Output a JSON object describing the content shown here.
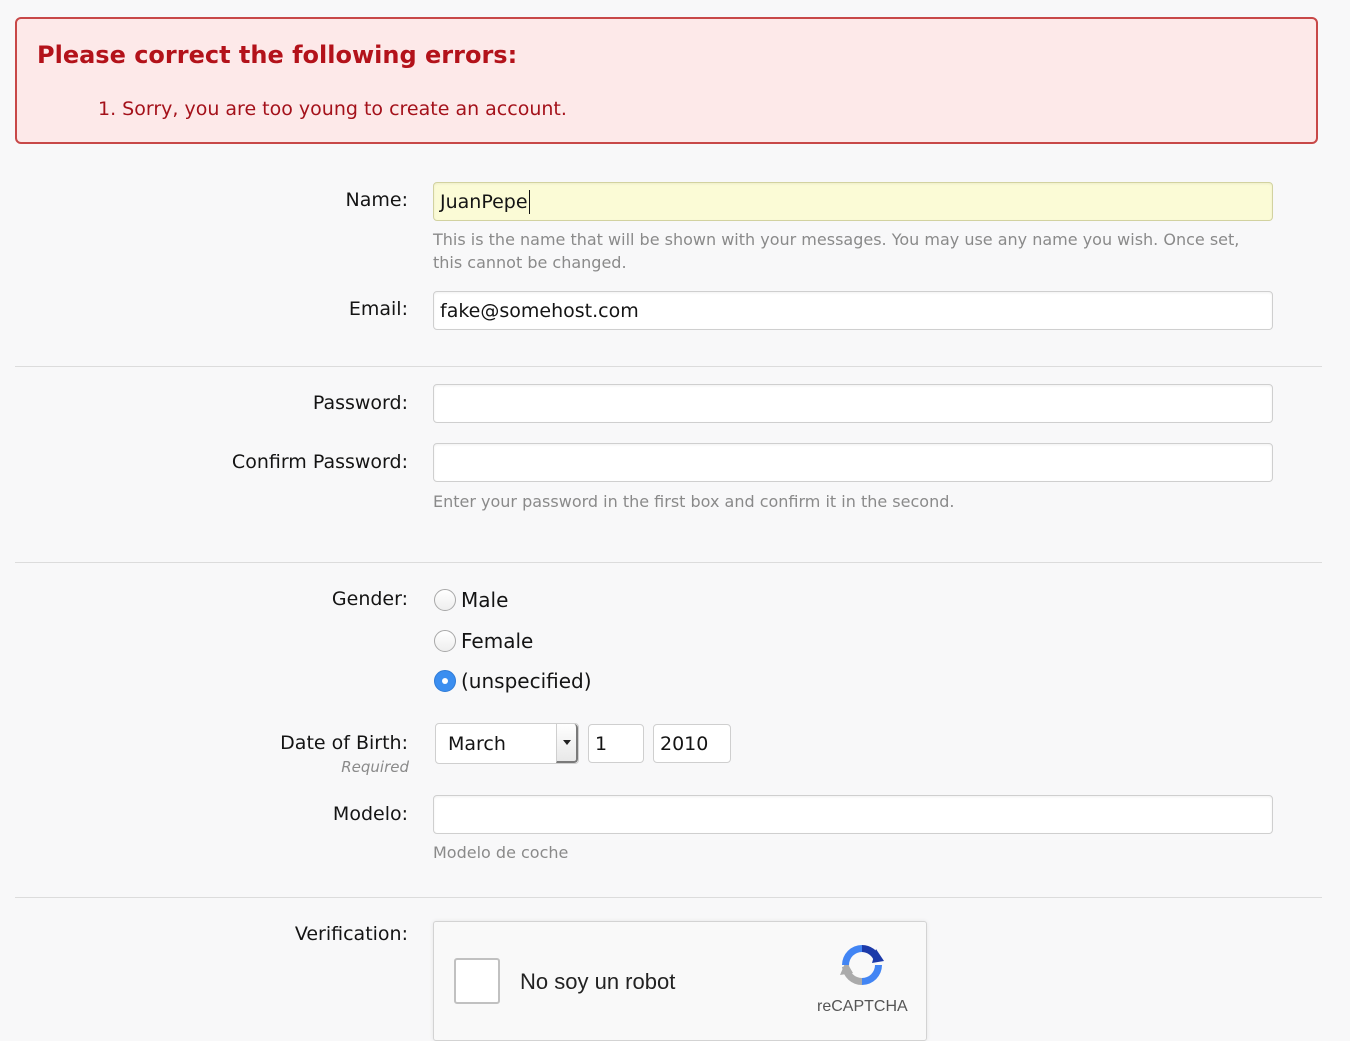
{
  "error": {
    "title": "Please correct the following errors:",
    "items": [
      "1. Sorry, you are too young to create an account."
    ]
  },
  "form": {
    "name": {
      "label": "Name:",
      "value": "JuanPepe",
      "hint": "This is the name that will be shown with your messages. You may use any name you wish. Once set, this cannot be changed."
    },
    "email": {
      "label": "Email:",
      "value": "fake@somehost.com"
    },
    "password": {
      "label": "Password:",
      "value": ""
    },
    "confirm_password": {
      "label": "Confirm Password:",
      "value": "",
      "hint": "Enter your password in the first box and confirm it in the second."
    },
    "gender": {
      "label": "Gender:",
      "options": [
        "Male",
        "Female",
        "(unspecified)"
      ],
      "selected": "(unspecified)"
    },
    "dob": {
      "label": "Date of Birth:",
      "sublabel": "Required",
      "month": "March",
      "day": "1",
      "year": "2010"
    },
    "modelo": {
      "label": "Modelo:",
      "value": "",
      "hint": "Modelo de coche"
    },
    "verification": {
      "label": "Verification:",
      "checkbox_text": "No soy un robot",
      "brand": "reCAPTCHA"
    }
  },
  "colors": {
    "error_border": "#c84848",
    "error_bg": "#fde9e9",
    "error_text": "#b3121a",
    "autofill_bg": "#fbfbd6",
    "radio_checked": "#3b8ef0"
  }
}
